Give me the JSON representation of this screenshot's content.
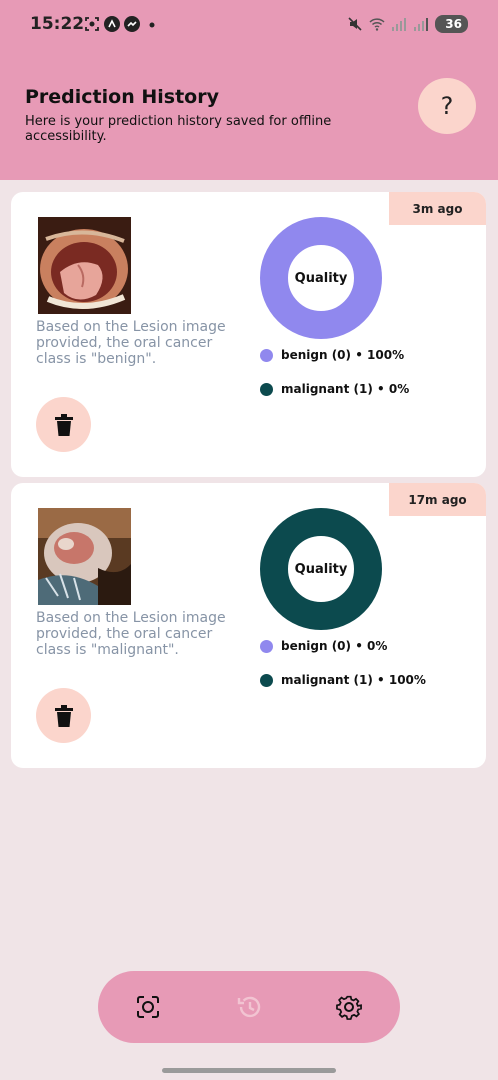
{
  "status_bar": {
    "time": "15:22",
    "battery": "36",
    "left_icons": [
      "screenshot-icon",
      "app-a-icon",
      "messenger-icon",
      "dot-icon"
    ],
    "right_icons": [
      "mute-icon",
      "wifi-icon",
      "signal-icon",
      "signal-icon",
      "battery-icon"
    ]
  },
  "header": {
    "title": "Prediction History",
    "subtitle": "Here is your prediction history saved for offline accessibility.",
    "help_label": "?"
  },
  "history": [
    {
      "time_ago": "3m ago",
      "caption": "Based on the Lesion image provided, the oral cancer class is \"benign\".",
      "chart_label": "Quality",
      "legend": [
        {
          "label": "benign (0) • 100%",
          "color": "#9088ee"
        },
        {
          "label": "malignant (1) • 0%",
          "color": "#0c4a4e"
        }
      ],
      "benign_pct": 100,
      "malignant_pct": 0
    },
    {
      "time_ago": "17m ago",
      "caption": "Based on the Lesion image provided, the oral cancer class is \"malignant\".",
      "chart_label": "Quality",
      "legend": [
        {
          "label": "benign (0) • 0%",
          "color": "#9088ee"
        },
        {
          "label": "malignant (1) • 100%",
          "color": "#0c4a4e"
        }
      ],
      "benign_pct": 0,
      "malignant_pct": 100
    }
  ],
  "bottom_nav": {
    "items": [
      "scan-icon",
      "history-icon",
      "settings-icon"
    ],
    "active": "history-icon"
  },
  "colors": {
    "accent": "#e79ab6",
    "badge": "#fbd5cc",
    "background": "#f0e4e7",
    "benign": "#9088ee",
    "malignant": "#0c4a4e",
    "caption": "#8794a6"
  }
}
